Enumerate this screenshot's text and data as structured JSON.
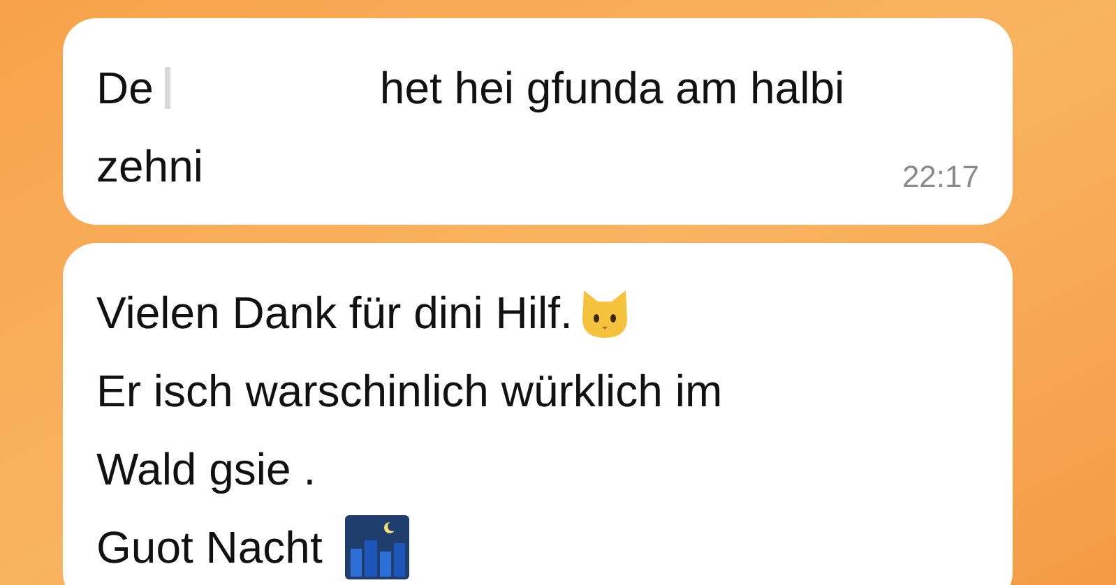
{
  "messages": [
    {
      "lines": [
        {
          "parts": [
            {
              "kind": "text",
              "text": "De"
            },
            {
              "kind": "redacted"
            },
            {
              "kind": "text",
              "text": "het hei gfunda am halbi"
            }
          ]
        },
        {
          "parts": [
            {
              "kind": "text",
              "text": "zehni"
            }
          ]
        }
      ],
      "time": "22:17"
    },
    {
      "lines": [
        {
          "parts": [
            {
              "kind": "text",
              "text": "Vielen Dank für dini Hilf."
            },
            {
              "kind": "cat"
            }
          ]
        },
        {
          "parts": [
            {
              "kind": "text",
              "text": "Er isch warschinlich würklich im"
            }
          ]
        },
        {
          "parts": [
            {
              "kind": "text",
              "text": "Wald gsie ."
            }
          ]
        },
        {
          "parts": [
            {
              "kind": "text",
              "text": "Guot Nacht"
            },
            {
              "kind": "city"
            }
          ]
        }
      ]
    }
  ]
}
